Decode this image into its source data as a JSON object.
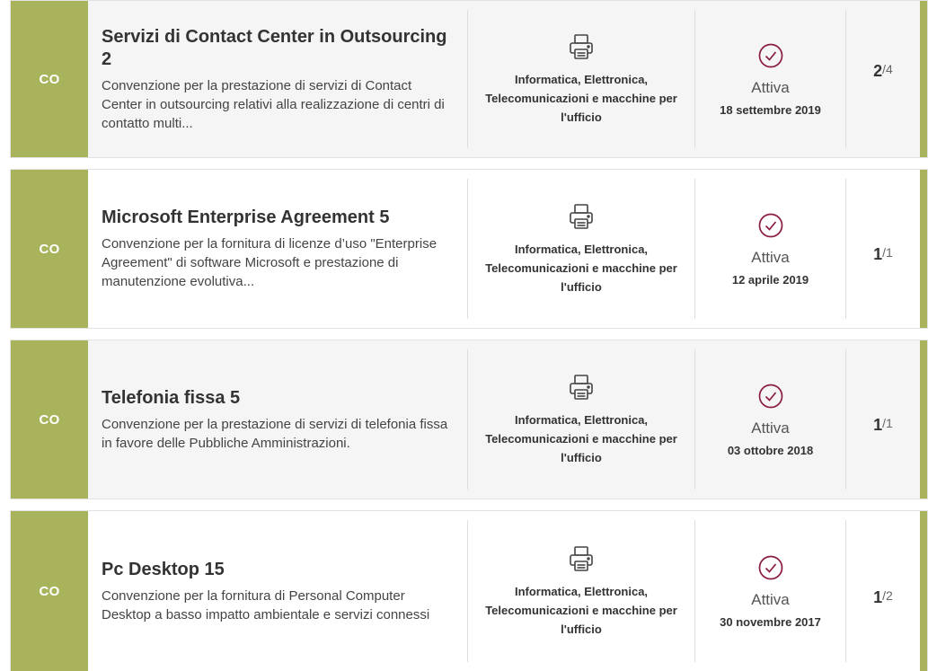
{
  "colors": {
    "accent": "#a8b35b",
    "status_icon": "#8b1d42"
  },
  "items": [
    {
      "badge": "CO",
      "title": "Servizi di Contact Center in Outsourcing 2",
      "description": "Convenzione per la prestazione di servizi di Contact Center in outsourcing relativi alla realizzazione di centri di contatto multi...",
      "category_icon": "printer-icon",
      "category": "Informatica, Elettronica, Telecomunicazioni e macchine per l'ufficio",
      "status_icon": "check-circle-icon",
      "status": "Attiva",
      "date": "18 settembre 2019",
      "lots_current": "2",
      "lots_total": "/4"
    },
    {
      "badge": "CO",
      "title": "Microsoft Enterprise Agreement 5",
      "description": "Convenzione per la fornitura di licenze d’uso \"Enterprise Agreement\" di software Microsoft e prestazione di manutenzione evolutiva...",
      "category_icon": "printer-icon",
      "category": "Informatica, Elettronica, Telecomunicazioni e macchine per l'ufficio",
      "status_icon": "check-circle-icon",
      "status": "Attiva",
      "date": "12 aprile 2019",
      "lots_current": "1",
      "lots_total": "/1"
    },
    {
      "badge": "CO",
      "title": "Telefonia fissa 5",
      "description": "Convenzione per la prestazione di servizi di telefonia fissa in favore delle Pubbliche Amministrazioni.",
      "category_icon": "printer-icon",
      "category": "Informatica, Elettronica, Telecomunicazioni e macchine per l'ufficio",
      "status_icon": "check-circle-icon",
      "status": "Attiva",
      "date": "03 ottobre 2018",
      "lots_current": "1",
      "lots_total": "/1"
    },
    {
      "badge": "CO",
      "title": "Pc Desktop 15",
      "description": "Convenzione per la fornitura di Personal Computer Desktop a basso impatto ambientale e servizi connessi",
      "category_icon": "printer-icon",
      "category": "Informatica, Elettronica, Telecomunicazioni e macchine per l'ufficio",
      "status_icon": "check-circle-icon",
      "status": "Attiva",
      "date": "30 novembre 2017",
      "lots_current": "1",
      "lots_total": "/2"
    }
  ]
}
